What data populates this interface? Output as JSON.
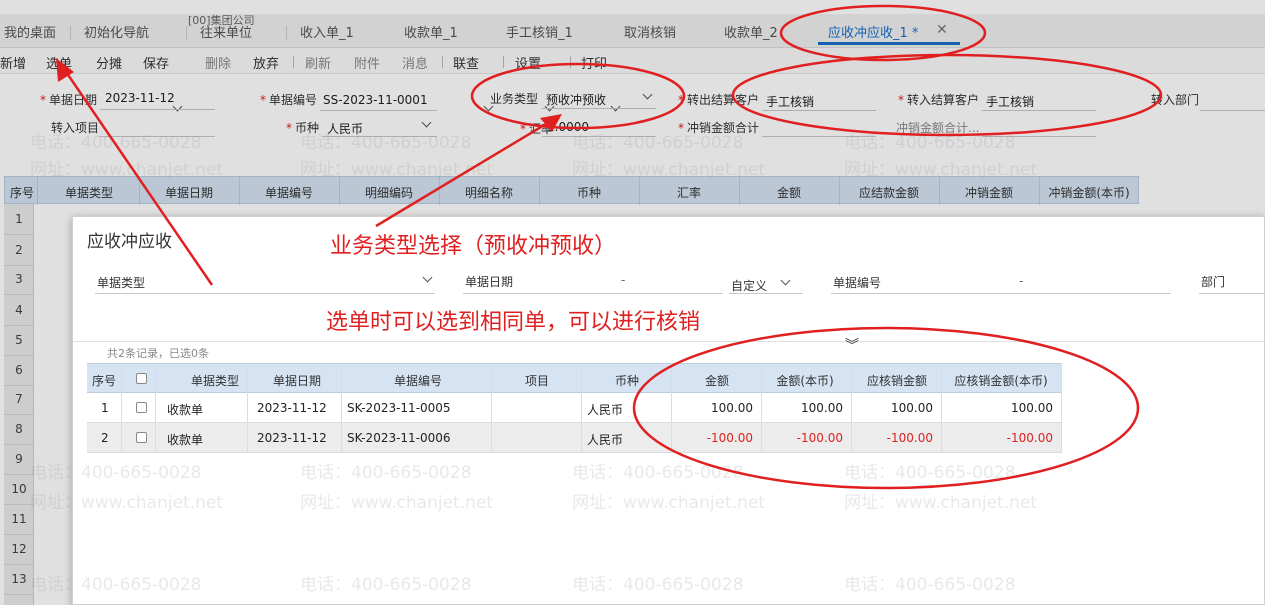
{
  "company": "[00]集团公司",
  "tabs": [
    "我的桌面",
    "初始化导航",
    "往来单位",
    "收入单_1",
    "收款单_1",
    "手工核销_1",
    "取消核销",
    "收款单_2",
    "应收冲应收_1 *"
  ],
  "toolbar": {
    "new": "新增",
    "select": "选单",
    "split": "分摊",
    "save": "保存",
    "delete": "删除",
    "discard": "放弃",
    "refresh": "刷新",
    "attach": "附件",
    "message": "消息",
    "link": "联查",
    "settings": "设置",
    "print": "打印"
  },
  "form": {
    "date_label": "单据日期",
    "date_value": "2023-11-12",
    "number_label": "单据编号",
    "number_value": "SS-2023-11-0001",
    "biztype_label": "业务类型",
    "biztype_value": "预收冲预收",
    "out_customer_label": "转出结算客户",
    "out_customer_value": "手工核销",
    "in_customer_label": "转入结算客户",
    "in_customer_value": "手工核销",
    "in_dept_label": "转入部门",
    "in_project_label": "转入项目",
    "currency_label": "币种",
    "currency_value": "人民币",
    "rate_label": "汇率",
    "rate_value": "1.0000",
    "offset_total_label": "冲销金额合计",
    "offset_total_cut": "冲销金额合计..."
  },
  "main_grid": {
    "headers": [
      "序号",
      "单据类型",
      "单据日期",
      "单据编号",
      "明细编码",
      "明细名称",
      "币种",
      "汇率",
      "金额",
      "应结款金额",
      "冲销金额",
      "冲销金额(本币)"
    ],
    "row_numbers": [
      "1",
      "2",
      "3",
      "4",
      "5",
      "6",
      "7",
      "8",
      "9",
      "10",
      "11",
      "12",
      "13"
    ]
  },
  "modal": {
    "title": "应收冲应收",
    "filter_doc_type": "单据类型",
    "filter_doc_date": "单据日期",
    "filter_custom": "自定义",
    "filter_doc_no": "单据编号",
    "filter_dept": "部门",
    "dash": "-",
    "record_count": "共2条记录，已选0条",
    "headers": [
      "序号",
      "单据类型",
      "单据日期",
      "单据编号",
      "项目",
      "币种",
      "金额",
      "金额(本币)",
      "应核销金额",
      "应核销金额(本币)"
    ],
    "rows": [
      {
        "no": "1",
        "type": "收款单",
        "date": "2023-11-12",
        "code": "SK-2023-11-0005",
        "project": "",
        "currency": "人民币",
        "amount": "100.00",
        "amount_local": "100.00",
        "verify": "100.00",
        "verify_local": "100.00"
      },
      {
        "no": "2",
        "type": "收款单",
        "date": "2023-11-12",
        "code": "SK-2023-11-0006",
        "project": "",
        "currency": "人民币",
        "amount": "-100.00",
        "amount_local": "-100.00",
        "verify": "-100.00",
        "verify_local": "-100.00"
      }
    ]
  },
  "annotations": {
    "biz_type_note": "业务类型选择（预收冲预收）",
    "select_note": "选单时可以选到相同单，可以进行核销"
  },
  "watermark": {
    "phone": "电话：400-665-0028",
    "site": "网址：www.chanjet.net"
  },
  "colors": {
    "accent": "#1a6fc9",
    "annotation": "#e02020",
    "header_bg": "#d5e3f2",
    "negative": "#e02020"
  }
}
